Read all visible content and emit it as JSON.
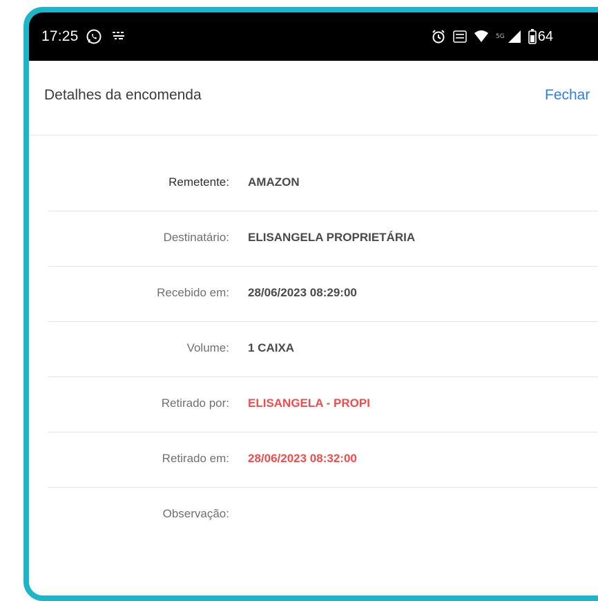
{
  "status_bar": {
    "time": "17:25",
    "battery_level": "64",
    "signal_5g_label": "5G",
    "volte_label": "Vo\nLTE",
    "icons": [
      "whatsapp-icon",
      "notification-icon",
      "alarm-icon",
      "volte-icon",
      "wifi-icon",
      "signal-icon",
      "battery-icon"
    ]
  },
  "header": {
    "title": "Detalhes da encomenda",
    "close_label": "Fechar"
  },
  "details": {
    "rows": [
      {
        "label": "Remetente:",
        "value": "AMAZON"
      },
      {
        "label": "Destinatário:",
        "value": "ELISANGELA PROPRIETÁRIA"
      },
      {
        "label": "Recebido em:",
        "value": "28/06/2023 08:29:00"
      },
      {
        "label": "Volume:",
        "value": "1 CAIXA"
      },
      {
        "label": "Retirado por:",
        "value": "ELISANGELA - PROPI"
      },
      {
        "label": "Retirado em:",
        "value": "28/06/2023 08:32:00"
      },
      {
        "label": "Observação:",
        "value": ""
      }
    ]
  },
  "colors": {
    "frame_border": "#1db6c9",
    "link_blue": "#2a7fea",
    "highlight_red": "#f14b4b",
    "status_bar_bg": "#000000"
  }
}
